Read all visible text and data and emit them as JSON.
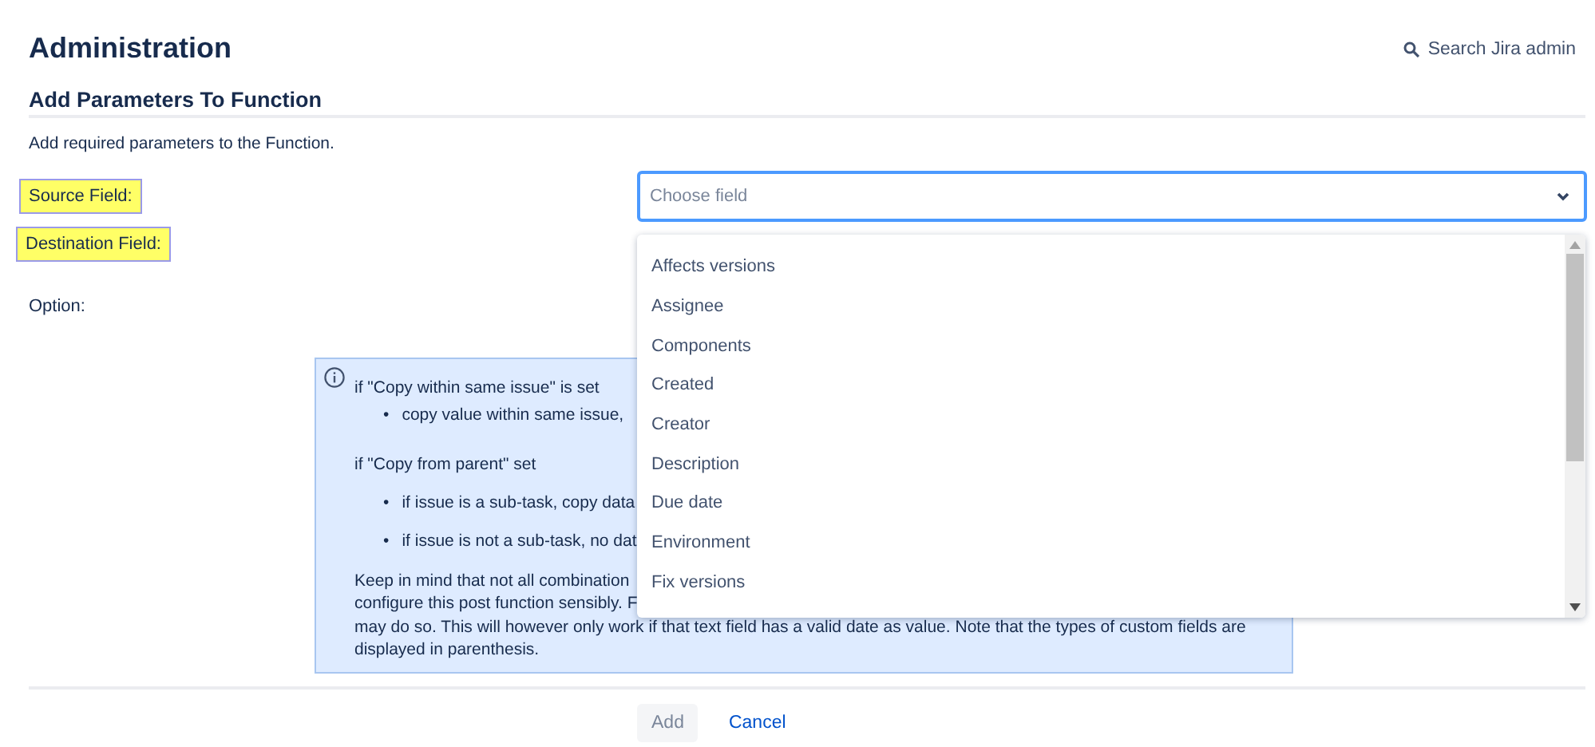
{
  "header": {
    "title": "Administration",
    "search_link": "Search Jira admin"
  },
  "section": {
    "title": "Add Parameters To Function",
    "description": "Add required parameters to the Function."
  },
  "form": {
    "fields": [
      {
        "label": "Source Field:",
        "highlighted": true
      },
      {
        "label": "Destination Field:",
        "highlighted": true
      },
      {
        "label": "Option:",
        "highlighted": false
      }
    ],
    "select": {
      "placeholder": "Choose field",
      "focused": true
    },
    "dropdown": {
      "options": [
        "Affects versions",
        "Assignee",
        "Components",
        "Created",
        "Creator",
        "Description",
        "Due date",
        "Environment",
        "Fix versions"
      ]
    },
    "info": {
      "sections": [
        {
          "title": "if \"Copy within same issue\" is set",
          "marker": "•",
          "bullets": [
            "copy value within same issue,"
          ]
        },
        {
          "title": "if \"Copy from parent\" set",
          "marker": "•",
          "bullets": [
            "if issue is a sub-task, copy data",
            "if issue is not a sub-task, no dat"
          ]
        }
      ],
      "note_lines": [
        "Keep in mind that not all combination",
        "configure this post function sensibly. F",
        "may do so. This will however only work if that text field has a valid date as value. Note that the types of custom fields are",
        "displayed in parenthesis."
      ]
    }
  },
  "buttons": [
    {
      "label": "Add",
      "kind": "primary",
      "disabled": true
    },
    {
      "label": "Cancel",
      "kind": "link",
      "disabled": false
    }
  ]
}
